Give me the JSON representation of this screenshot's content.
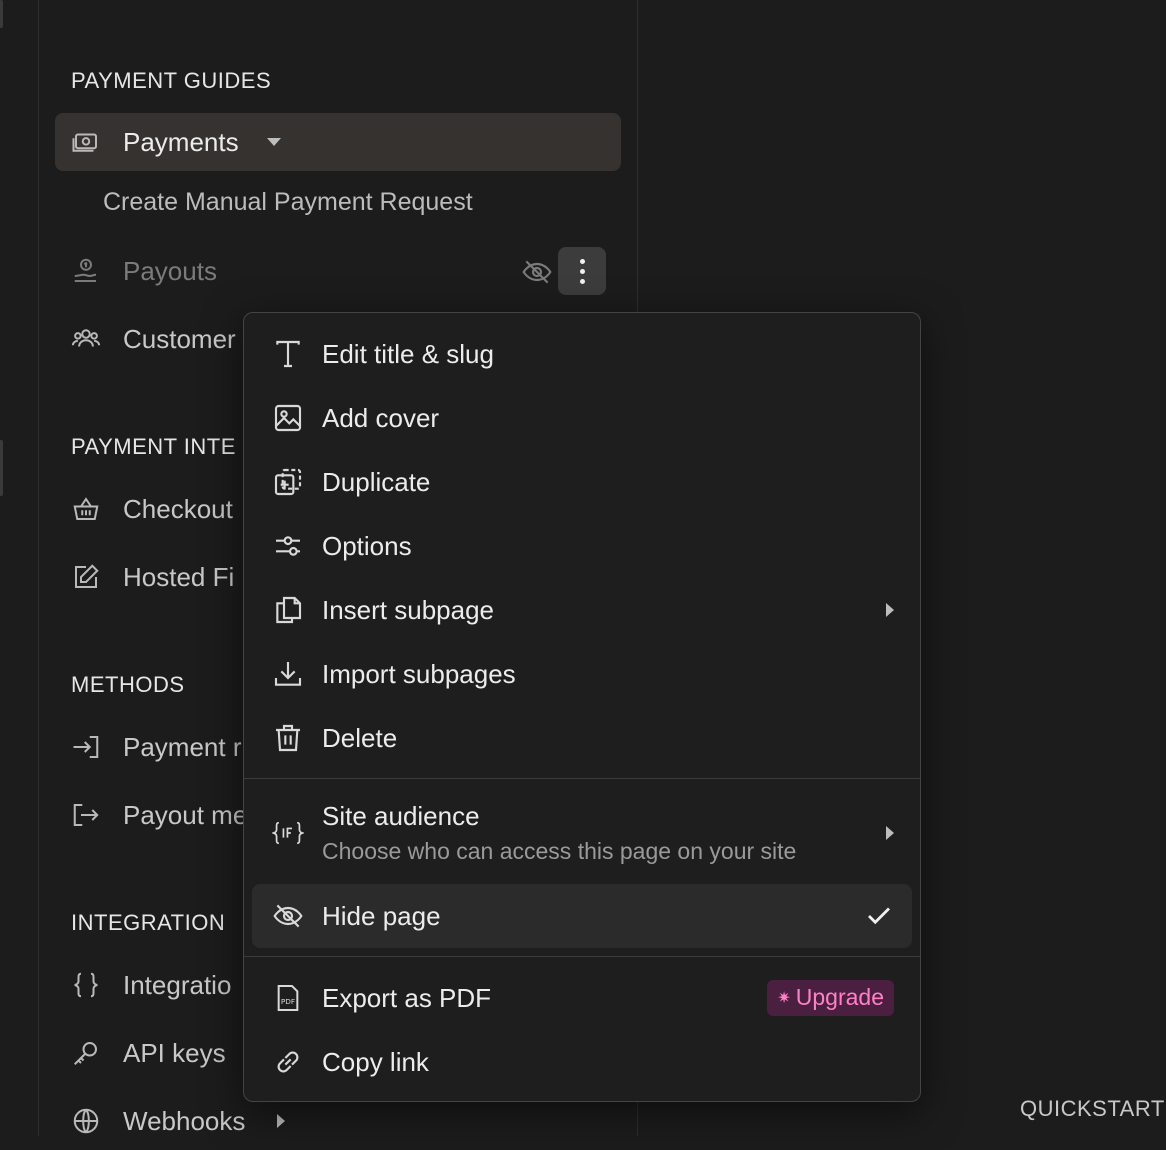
{
  "sidebar": {
    "sections": {
      "payment_guides": "PAYMENT GUIDES",
      "payment_integrations": "PAYMENT INTE",
      "methods": "METHODS",
      "integration": "INTEGRATION"
    },
    "items": {
      "payments": "Payments",
      "create_manual": "Create Manual Payment Request",
      "payouts": "Payouts",
      "customers": "Customer",
      "checkout": "Checkout",
      "hosted_fields": "Hosted Fi",
      "payment_methods": "Payment r",
      "payout_methods": "Payout me",
      "integrations": "Integratio",
      "api_keys": "API keys",
      "webhooks": "Webhooks"
    }
  },
  "context_menu": {
    "edit_title": "Edit title & slug",
    "add_cover": "Add cover",
    "duplicate": "Duplicate",
    "options": "Options",
    "insert_subpage": "Insert subpage",
    "import_subpages": "Import subpages",
    "delete": "Delete",
    "site_audience": "Site audience",
    "site_audience_desc": "Choose who can access this page on your site",
    "hide_page": "Hide page",
    "export_pdf": "Export as PDF",
    "upgrade_badge": "Upgrade",
    "copy_link": "Copy link"
  },
  "right_panel": {
    "quickstart": "QUICKSTART"
  },
  "colors": {
    "background": "#1c1c1c",
    "active_item": "#353230",
    "badge_bg": "#4a1f3f",
    "badge_text": "#ff80c8"
  }
}
